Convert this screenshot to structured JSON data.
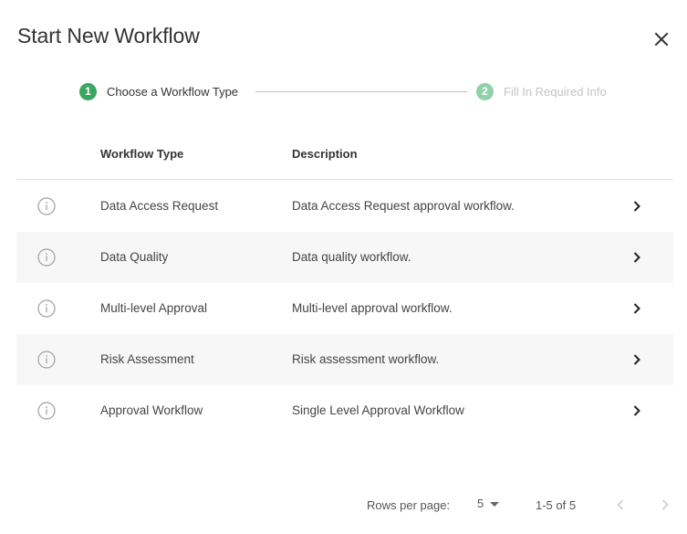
{
  "dialog": {
    "title": "Start New Workflow",
    "close_icon": "close-icon"
  },
  "stepper": {
    "steps": [
      {
        "number": "1",
        "label": "Choose a Workflow Type",
        "state": "active",
        "color": "#3aa660"
      },
      {
        "number": "2",
        "label": "Fill In Required Info",
        "state": "inactive",
        "color": "#8fd1a8"
      }
    ]
  },
  "table": {
    "columns": {
      "type": "Workflow Type",
      "description": "Description"
    },
    "rows": [
      {
        "type": "Data Access Request",
        "description": "Data Access Request approval workflow."
      },
      {
        "type": "Data Quality",
        "description": "Data quality workflow."
      },
      {
        "type": "Multi-level Approval",
        "description": "Multi-level approval workflow."
      },
      {
        "type": "Risk Assessment",
        "description": "Risk assessment workflow."
      },
      {
        "type": "Approval Workflow",
        "description": "Single Level Approval Workflow"
      }
    ]
  },
  "pagination": {
    "rows_per_page_label": "Rows per page:",
    "rows_per_page_value": "5",
    "range_label": "1-5 of 5"
  }
}
